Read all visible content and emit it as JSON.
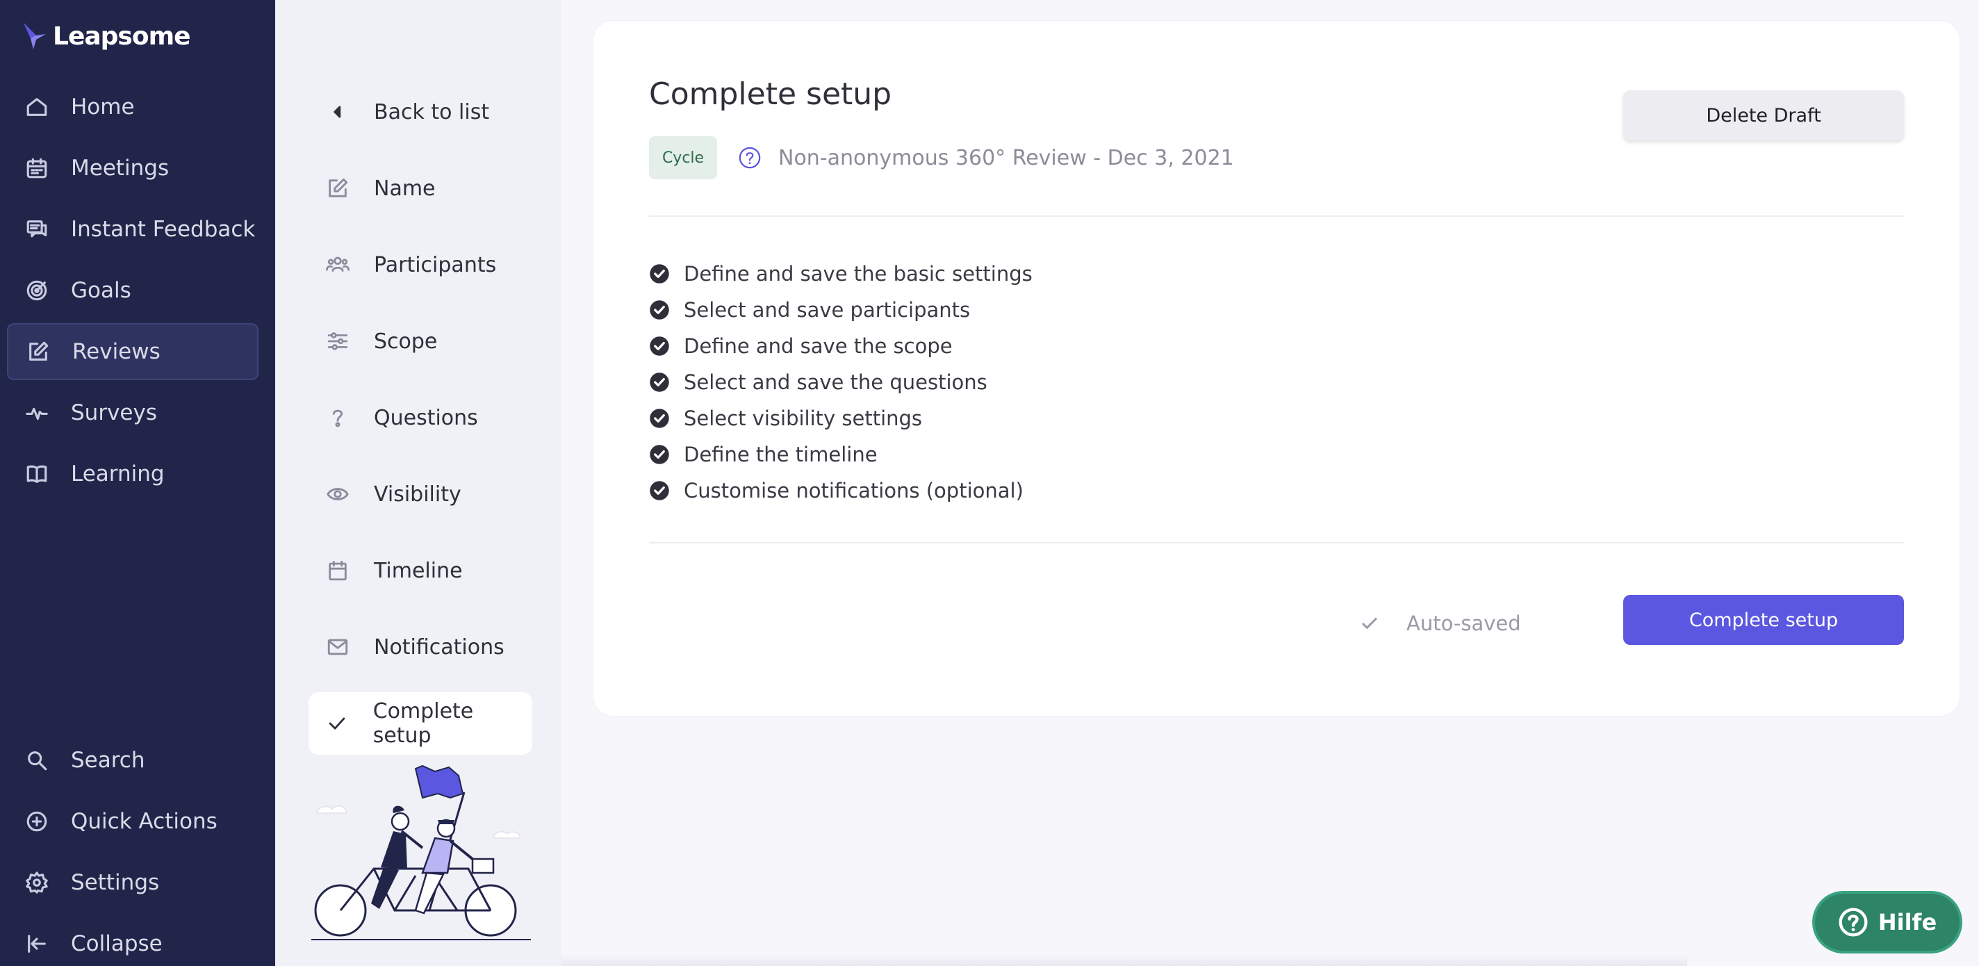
{
  "brand": {
    "name": "Leapsome"
  },
  "nav": {
    "top_items": [
      {
        "label": "Home",
        "icon": "home-icon"
      },
      {
        "label": "Meetings",
        "icon": "calendar-icon"
      },
      {
        "label": "Instant Feedback",
        "icon": "chat-icon"
      },
      {
        "label": "Goals",
        "icon": "target-icon"
      },
      {
        "label": "Reviews",
        "icon": "edit-icon",
        "active": true
      },
      {
        "label": "Surveys",
        "icon": "pulse-icon"
      },
      {
        "label": "Learning",
        "icon": "book-icon"
      }
    ],
    "bottom_items": [
      {
        "label": "Search",
        "icon": "search-icon"
      },
      {
        "label": "Quick Actions",
        "icon": "plus-circle-icon"
      },
      {
        "label": "Settings",
        "icon": "gear-icon"
      },
      {
        "label": "Collapse",
        "icon": "collapse-icon"
      }
    ]
  },
  "steps": {
    "back_label": "Back to list",
    "items": [
      {
        "label": "Name",
        "icon": "edit-icon"
      },
      {
        "label": "Participants",
        "icon": "people-icon"
      },
      {
        "label": "Scope",
        "icon": "sliders-icon"
      },
      {
        "label": "Questions",
        "icon": "question-icon"
      },
      {
        "label": "Visibility",
        "icon": "eye-icon"
      },
      {
        "label": "Timeline",
        "icon": "calendar-icon"
      },
      {
        "label": "Notifications",
        "icon": "mail-icon"
      },
      {
        "label": "Complete setup",
        "icon": "check-icon",
        "active": true
      }
    ]
  },
  "main": {
    "title": "Complete setup",
    "badge": "Cycle",
    "cycle_name": "Non-anonymous 360° Review - Dec 3, 2021",
    "delete_label": "Delete Draft",
    "checklist": [
      "Define and save the basic settings",
      "Select and save participants",
      "Define and save the scope",
      "Select and save the questions",
      "Select visibility settings",
      "Define the timeline",
      "Customise notifications (optional)"
    ],
    "autosaved_label": "Auto-saved",
    "complete_label": "Complete setup"
  },
  "help": {
    "label": "Hilfe"
  },
  "colors": {
    "nav_bg": "#22254a",
    "accent": "#5b57e0",
    "badge_bg": "#e4efe9",
    "help_bg": "#2d8467"
  }
}
